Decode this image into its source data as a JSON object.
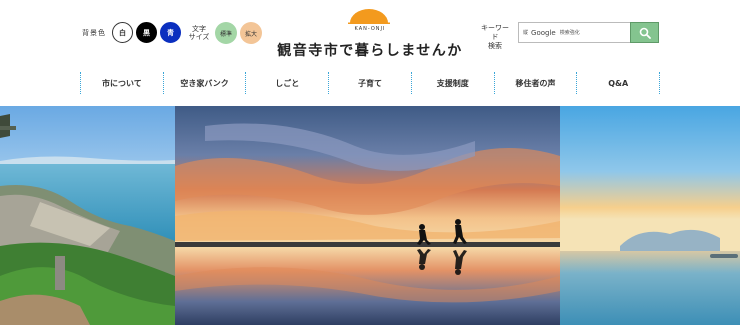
{
  "controls": {
    "bgcolor_label": "背景色",
    "bgcolor_white": "白",
    "bgcolor_black": "黒",
    "bgcolor_blue": "青",
    "fontsize_label_line1": "文字",
    "fontsize_label_line2": "サイズ",
    "fontsize_normal": "標準",
    "fontsize_large": "拡大"
  },
  "logo": {
    "subtitle": "KAN-ONJI",
    "title": "観音寺市で暮らしませんか",
    "sun_color": "#f39a1e"
  },
  "search": {
    "label_line1": "キーワード",
    "label_line2": "検索",
    "google_text": "Google",
    "powered_text": "検索強化",
    "prefix": "縦",
    "button_icon": "search-icon",
    "button_color": "#84c48f"
  },
  "nav": {
    "items": [
      {
        "label": "市について"
      },
      {
        "label": "空き家バンク"
      },
      {
        "label": "しごと"
      },
      {
        "label": "子育て"
      },
      {
        "label": "支援制度"
      },
      {
        "label": "移住者の声"
      },
      {
        "label": "Q&A"
      }
    ],
    "divider_color": "#3aa6d8"
  }
}
